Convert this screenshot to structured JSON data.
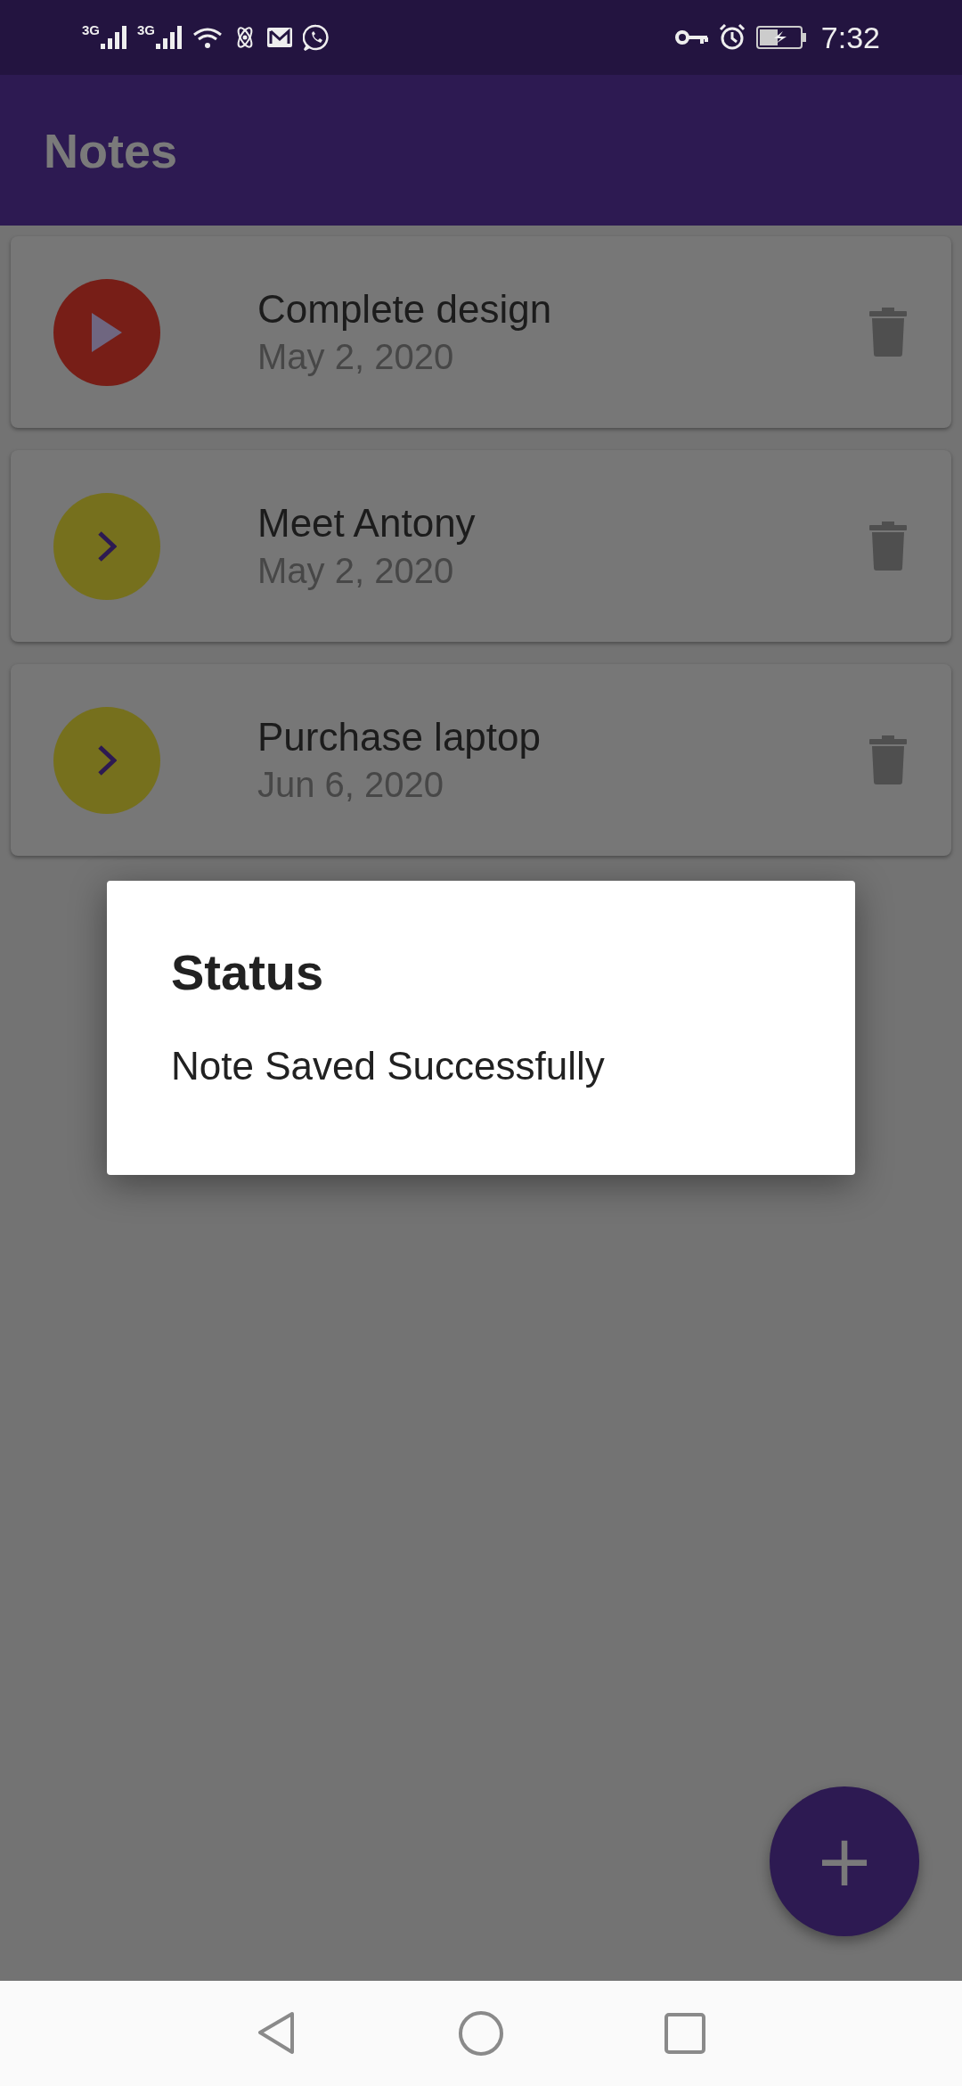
{
  "status_bar": {
    "network_labels": [
      "3G",
      "3G"
    ],
    "time": "7:32"
  },
  "app_bar": {
    "title": "Notes"
  },
  "notes": [
    {
      "title": "Complete design",
      "date": "May 2, 2020",
      "kind": "play",
      "color": "#771e17"
    },
    {
      "title": "Meet Antony",
      "date": "May 2, 2020",
      "kind": "chevron",
      "color": "#76701d"
    },
    {
      "title": "Purchase laptop",
      "date": "Jun 6, 2020",
      "kind": "chevron",
      "color": "#76701d"
    }
  ],
  "dialog": {
    "title": "Status",
    "message": "Note Saved Successfully"
  },
  "fab": {
    "label": "+"
  }
}
